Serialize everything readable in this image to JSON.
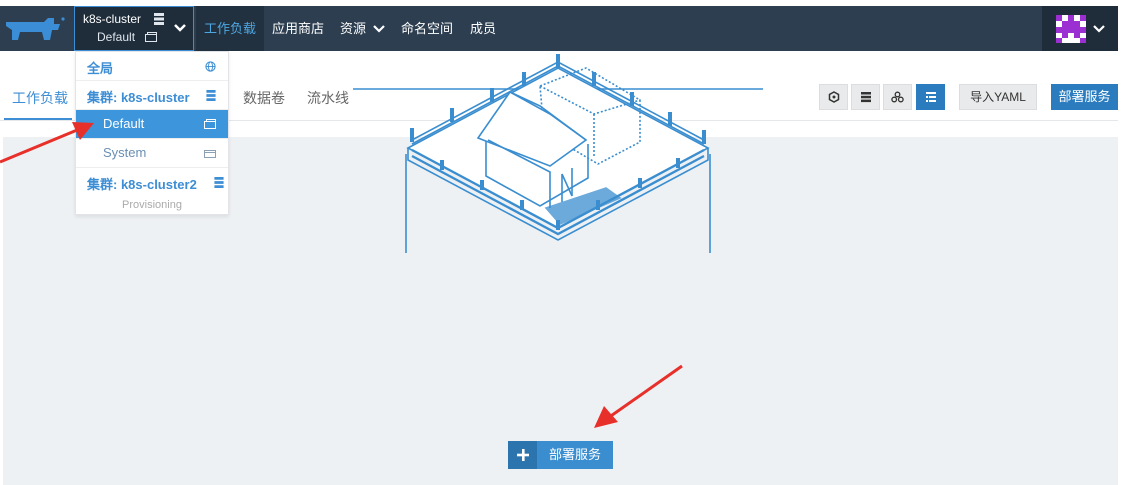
{
  "topbar": {
    "cluster_name": "k8s-cluster",
    "project_name": "Default",
    "nav": [
      "工作负载",
      "应用商店",
      "资源",
      "命名空间",
      "成员"
    ]
  },
  "subtabs": [
    "工作负载",
    "数据卷",
    "流水线"
  ],
  "toolbar": {
    "import_label": "导入YAML",
    "deploy_label": "部署服务"
  },
  "dropdown": {
    "global_label": "全局",
    "cluster1_label": "集群: k8s-cluster",
    "default_label": "Default",
    "system_label": "System",
    "cluster2_label": "集群: k8s-cluster2",
    "cluster2_status": "Provisioning"
  },
  "empty_state": {
    "cta_label": "部署服务"
  },
  "colors": {
    "nav_bg": "#2c3e50",
    "accent": "#3d8ed4",
    "primary_button": "#2a7cbf",
    "annotation_arrow": "#e8302a"
  }
}
